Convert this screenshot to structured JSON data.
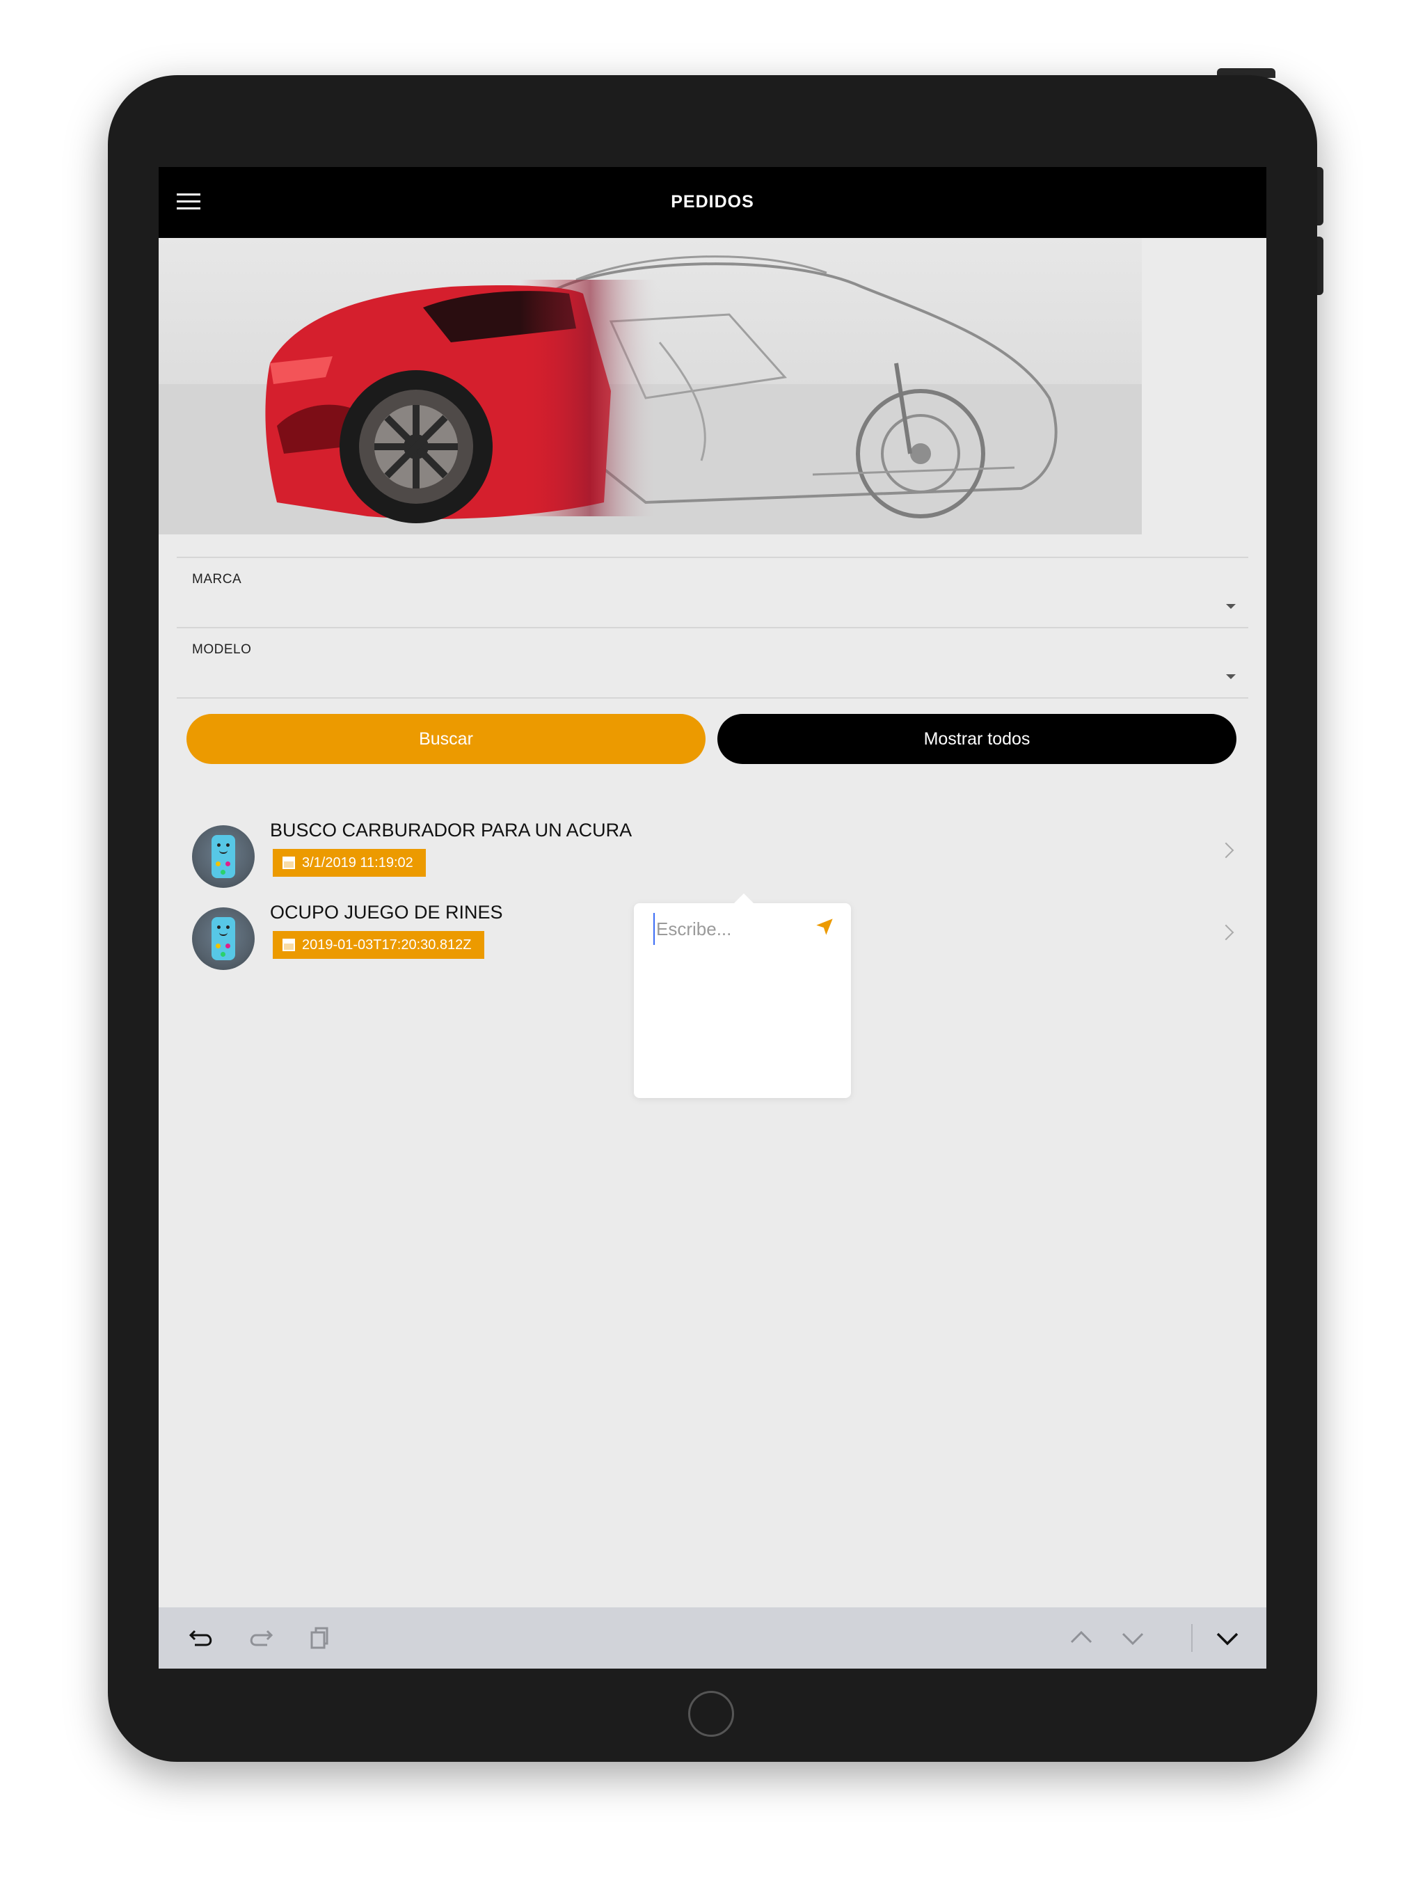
{
  "app": {
    "title": "PEDIDOS"
  },
  "colors": {
    "accent": "#ec9a00",
    "navbar": "#000000",
    "background": "#ebebeb"
  },
  "icons": {
    "menu": "hamburger-icon",
    "dropdown": "caret-down-icon",
    "calendar": "calendar-icon",
    "chevron": "chevron-right-icon",
    "send": "send-arrow-icon",
    "undo": "undo-icon",
    "redo": "redo-icon",
    "paste": "paste-icon",
    "prev": "chevron-up-icon",
    "next": "chevron-down-icon",
    "dismiss": "keyboard-dismiss-icon"
  },
  "form": {
    "marca_label": "MARCA",
    "modelo_label": "MODELO",
    "buscar_label": "Buscar",
    "mostrar_label": "Mostrar todos"
  },
  "orders": [
    {
      "title": "BUSCO CARBURADOR PARA UN ACURA",
      "date": "3/1/2019 11:19:02"
    },
    {
      "title": "OCUPO JUEGO DE RINES",
      "date": "2019-01-03T17:20:30.812Z"
    }
  ],
  "popover": {
    "placeholder": "Escribe..."
  }
}
